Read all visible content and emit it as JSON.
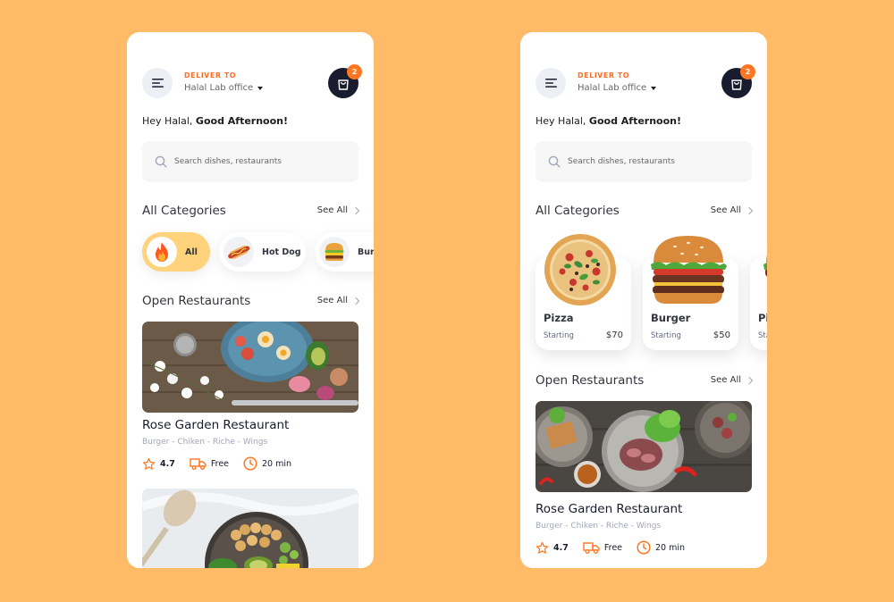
{
  "colors": {
    "background": "#FFBB68",
    "accent": "#FF7622",
    "dark": "#181C2E"
  },
  "screen": {
    "deliver_label": "DELIVER TO",
    "deliver_value": "Halal Lab office",
    "cart_count": "2",
    "greeting_prefix": "Hey Halal,",
    "greeting_bold": "Good Afternoon!",
    "search_placeholder": "Search dishes, restaurants",
    "categories_title": "All Categories",
    "open_restaurants_title": "Open Restaurants",
    "see_all": "See All"
  },
  "chips": [
    {
      "label": "All",
      "icon": "fire-icon",
      "active": true
    },
    {
      "label": "Hot Dog",
      "icon": "hot-dog-icon",
      "active": false
    },
    {
      "label": "Burger",
      "icon": "burger-icon",
      "active": false
    }
  ],
  "category_cards": [
    {
      "name": "Pizza",
      "starting": "Starting",
      "price": "$70",
      "icon": "pizza-icon"
    },
    {
      "name": "Burger",
      "starting": "Starting",
      "price": "$50",
      "icon": "burger-icon"
    },
    {
      "name": "Pi",
      "starting": "Sta",
      "price": "",
      "icon": "pizza-icon"
    }
  ],
  "restaurant": {
    "name": "Rose Garden Restaurant",
    "tags": "Burger - Chiken - Riche - Wings",
    "rating": "4.7",
    "delivery": "Free",
    "time": "20 min"
  }
}
